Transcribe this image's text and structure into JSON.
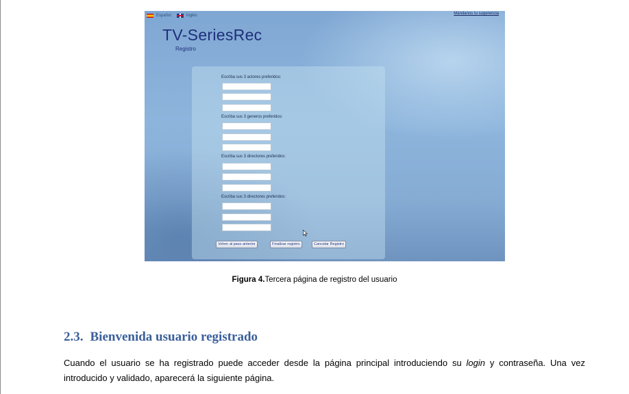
{
  "figure": {
    "lang_es": "Español",
    "lang_en": "Inglés",
    "suggestions_link": "Mándanos tu sugerencia",
    "app_title": "TV-SeriesRec",
    "app_subtitle": "Registro",
    "form": {
      "label_actors": "Escriba sus 3 actores preferidos:",
      "label_genres": "Escriba sus 3 generos preferidos:",
      "label_directors_1": "Escriba sus 3 directores preferidos:",
      "label_directors_2": "Escriba sus 3 directores preferidos:",
      "btn_back": "Volver al paso anterior",
      "btn_finish": "Finalizar registro",
      "btn_cancel": "Cancelar Registro"
    }
  },
  "caption": {
    "label": "Figura 4.",
    "text": "Tercera página de registro del usuario"
  },
  "section": {
    "number": "2.3.",
    "title": "Bienvenida usuario registrado"
  },
  "paragraph": {
    "part1": "Cuando el usuario se ha registrado puede acceder desde la página principal introduciendo su ",
    "emphasis": "login",
    "part2": " y contraseña. Una vez introducido y validado, aparecerá la siguiente página."
  }
}
